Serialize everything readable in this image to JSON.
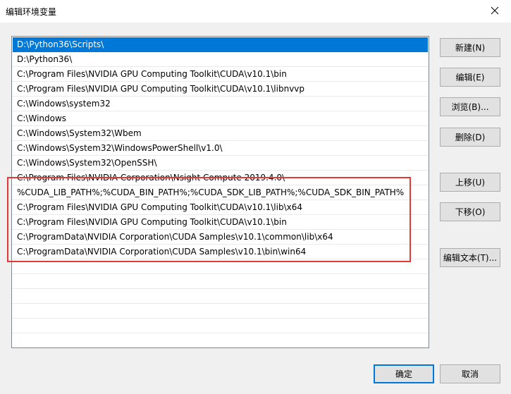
{
  "window": {
    "title": "编辑环境变量"
  },
  "paths": [
    "D:\\Python36\\Scripts\\",
    "D:\\Python36\\",
    "C:\\Program Files\\NVIDIA GPU Computing Toolkit\\CUDA\\v10.1\\bin",
    "C:\\Program Files\\NVIDIA GPU Computing Toolkit\\CUDA\\v10.1\\libnvvp",
    "C:\\Windows\\system32",
    "C:\\Windows",
    "C:\\Windows\\System32\\Wbem",
    "C:\\Windows\\System32\\WindowsPowerShell\\v1.0\\",
    "C:\\Windows\\System32\\OpenSSH\\",
    "C:\\Program Files\\NVIDIA Corporation\\Nsight Compute 2019.4.0\\",
    "%CUDA_LIB_PATH%;%CUDA_BIN_PATH%;%CUDA_SDK_LIB_PATH%;%CUDA_SDK_BIN_PATH%",
    "C:\\Program Files\\NVIDIA GPU Computing Toolkit\\CUDA\\v10.1\\lib\\x64",
    "C:\\Program Files\\NVIDIA GPU Computing Toolkit\\CUDA\\v10.1\\bin",
    "C:\\ProgramData\\NVIDIA Corporation\\CUDA Samples\\v10.1\\common\\lib\\x64",
    "C:\\ProgramData\\NVIDIA Corporation\\CUDA Samples\\v10.1\\bin\\win64"
  ],
  "selected_index": 0,
  "buttons": {
    "new": "新建(N)",
    "edit": "编辑(E)",
    "browse": "浏览(B)...",
    "delete": "删除(D)",
    "move_up": "上移(U)",
    "move_down": "下移(O)",
    "edit_text": "编辑文本(T)...",
    "ok": "确定",
    "cancel": "取消"
  },
  "colors": {
    "selection": "#0078d7",
    "highlight_box": "#e53935"
  }
}
